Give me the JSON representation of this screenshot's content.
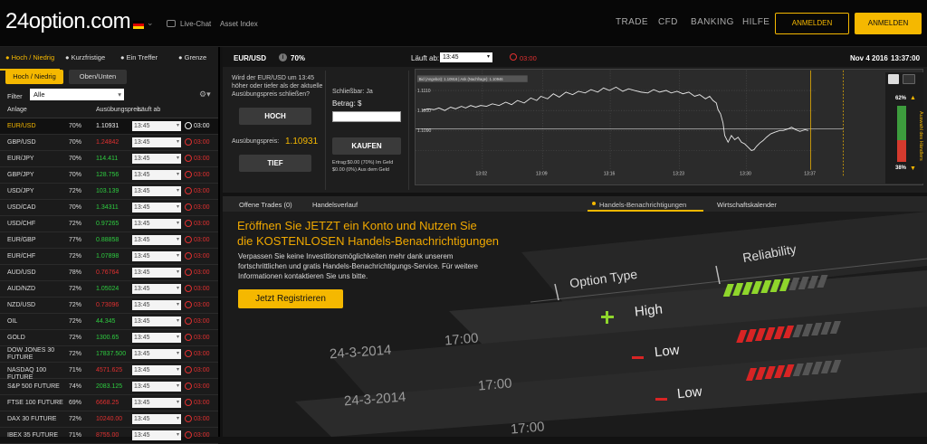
{
  "header": {
    "logo": "24option.com",
    "live_chat": "Live-Chat",
    "asset_index": "Asset Index",
    "nav": [
      "TRADE",
      "CFD",
      "BANKING",
      "HILFE"
    ],
    "login_outline": "ANMELDEN",
    "login_solid": "ANMELDEN",
    "colors": {
      "accent": "#f5b800",
      "down": "#e03030",
      "up": "#2ecc40"
    }
  },
  "left": {
    "tabs": [
      "Hoch / Niedrig",
      "Kurzfristige",
      "Ein Treffer",
      "Grenze"
    ],
    "subtabs": [
      "Hoch / Niedrig",
      "Oben/Unten"
    ],
    "filter_label": "Filter",
    "filter_value": "Alle",
    "col_asset": "Anlage",
    "col_strike": "Ausübungspreis",
    "col_expiry": "Läuft ab",
    "rows": [
      {
        "name": "EUR/USD",
        "pct": "70%",
        "price": "1.10931",
        "dir": "neutral",
        "sel": "13:45",
        "time": "03:00",
        "selected": true
      },
      {
        "name": "GBP/USD",
        "pct": "70%",
        "price": "1.24842",
        "dir": "down",
        "sel": "13:45",
        "time": "03:00"
      },
      {
        "name": "EUR/JPY",
        "pct": "70%",
        "price": "114.411",
        "dir": "up",
        "sel": "13:45",
        "time": "03:00"
      },
      {
        "name": "GBP/JPY",
        "pct": "70%",
        "price": "128.756",
        "dir": "up",
        "sel": "13:45",
        "time": "03:00"
      },
      {
        "name": "USD/JPY",
        "pct": "72%",
        "price": "103.139",
        "dir": "up",
        "sel": "13:45",
        "time": "03:00"
      },
      {
        "name": "USD/CAD",
        "pct": "70%",
        "price": "1.34311",
        "dir": "up",
        "sel": "13:45",
        "time": "03:00"
      },
      {
        "name": "USD/CHF",
        "pct": "72%",
        "price": "0.97265",
        "dir": "up",
        "sel": "13:45",
        "time": "03:00"
      },
      {
        "name": "EUR/GBP",
        "pct": "77%",
        "price": "0.88858",
        "dir": "up",
        "sel": "13:45",
        "time": "03:00"
      },
      {
        "name": "EUR/CHF",
        "pct": "72%",
        "price": "1.07898",
        "dir": "up",
        "sel": "13:45",
        "time": "03:00"
      },
      {
        "name": "AUD/USD",
        "pct": "78%",
        "price": "0.76764",
        "dir": "down",
        "sel": "13:45",
        "time": "03:00"
      },
      {
        "name": "AUD/NZD",
        "pct": "72%",
        "price": "1.05024",
        "dir": "up",
        "sel": "13:45",
        "time": "03:00"
      },
      {
        "name": "NZD/USD",
        "pct": "72%",
        "price": "0.73096",
        "dir": "down",
        "sel": "13:45",
        "time": "03:00"
      },
      {
        "name": "OIL",
        "pct": "72%",
        "price": "44.345",
        "dir": "up",
        "sel": "13:45",
        "time": "03:00"
      },
      {
        "name": "GOLD",
        "pct": "72%",
        "price": "1300.65",
        "dir": "up",
        "sel": "13:45",
        "time": "03:00"
      },
      {
        "name": "DOW JONES 30 FUTURE",
        "pct": "72%",
        "price": "17837.500",
        "dir": "up",
        "sel": "13:45",
        "time": "03:00",
        "two": true
      },
      {
        "name": "NASDAQ 100 FUTURE",
        "pct": "71%",
        "price": "4571.625",
        "dir": "down",
        "sel": "13:45",
        "time": "03:00"
      },
      {
        "name": "S&P 500 FUTURE",
        "pct": "74%",
        "price": "2083.125",
        "dir": "up",
        "sel": "13:45",
        "time": "03:00"
      },
      {
        "name": "FTSE 100 FUTURE",
        "pct": "69%",
        "price": "6668.25",
        "dir": "down",
        "sel": "13:45",
        "time": "03:00"
      },
      {
        "name": "DAX 30 FUTURE",
        "pct": "72%",
        "price": "10240.00",
        "dir": "down",
        "sel": "13:45",
        "time": "03:00"
      },
      {
        "name": "IBEX 35 FUTURE",
        "pct": "71%",
        "price": "8755.00",
        "dir": "down",
        "sel": "13:45",
        "time": "03:00"
      }
    ]
  },
  "trade": {
    "pair": "EUR/USD",
    "pct": "70%",
    "expiry_label": "Läuft ab:",
    "expiry_value": "13:45",
    "countdown": "03:00",
    "date": "Nov 4 2016",
    "time": "13:37:00",
    "question": "Wird der EUR/USD um 13:45 höher oder tiefer als der aktuelle Ausübungspreis schließen?",
    "hoch": "HOCH",
    "tief": "TIEF",
    "strike_label": "Ausübungspreis:",
    "strike_value": "1.10931",
    "closable": "Schließbar: Ja",
    "amount_label": "Betrag:  $",
    "buy": "KAUFEN",
    "return_text": "Ertrag:$0.00 (70%) Im Geld",
    "return_text2": "$0.00 (0%) Aus dem Geld"
  },
  "chart": {
    "legend": "Bid (Angebot): 1.10916  |  Ask (Nachfrage): 1.10946",
    "y_ticks": [
      "1.1110",
      "1.1100",
      "1.1090"
    ],
    "x_ticks": [
      "13:02",
      "13:09",
      "13:16",
      "13:23",
      "13:30",
      "13:37"
    ],
    "pct_top": "62%",
    "pct_bottom": "38%",
    "gauge_up": 0.62,
    "vertical_label": "Auswahl des Händlers"
  },
  "bottom_tabs": [
    "Offene Trades (0)",
    "Handelsverlauf",
    "Handels-Benachrichtigungen",
    "Wirtschaftskalender"
  ],
  "promo": {
    "headline1": "Eröffnen Sie JETZT ein Konto und Nutzen Sie",
    "headline2": "die KOSTENLOSEN Handels-Benachrichtigungen",
    "body": "Verpassen Sie keine Investitionsmöglichkeiten mehr dank unserem fortschrittlichen und gratis Handels-Benachrichtigungs-Service. Für weitere Informationen kontaktieren Sie uns bitte.",
    "button": "Jetzt Registrieren",
    "col_option": "Option Type",
    "col_reliability": "Reliability",
    "high": "High",
    "low": "Low",
    "date": "24-3-2014",
    "time": "17:00"
  }
}
